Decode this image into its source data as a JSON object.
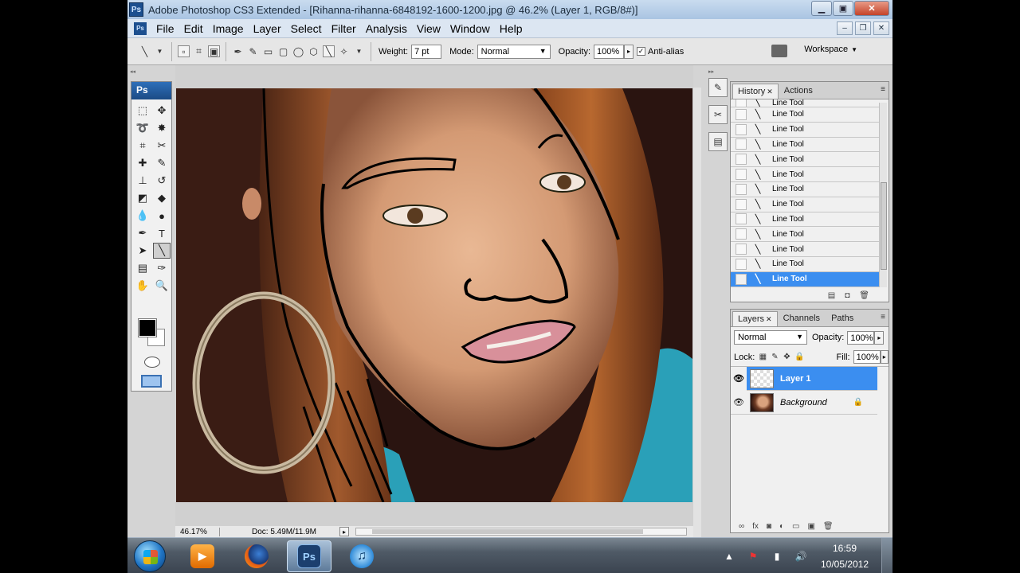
{
  "window": {
    "title": "Adobe Photoshop CS3 Extended - [Rihanna-rihanna-6848192-1600-1200.jpg @ 46.2% (Layer 1, RGB/8#)]",
    "app_badge": "Ps"
  },
  "menu": [
    "File",
    "Edit",
    "Image",
    "Layer",
    "Select",
    "Filter",
    "Analysis",
    "View",
    "Window",
    "Help"
  ],
  "options": {
    "weight_label": "Weight:",
    "weight_value": "7 pt",
    "mode_label": "Mode:",
    "mode_value": "Normal",
    "opacity_label": "Opacity:",
    "opacity_value": "100%",
    "antialias_label": "Anti-alias",
    "antialias_checked": true,
    "workspace_label": "Workspace"
  },
  "toolbox": {
    "logo": "Ps"
  },
  "status": {
    "zoom": "46.17%",
    "doc": "Doc: 5.49M/11.9M"
  },
  "history": {
    "tabs": [
      "History",
      "Actions"
    ],
    "items": [
      "Line Tool",
      "Line Tool",
      "Line Tool",
      "Line Tool",
      "Line Tool",
      "Line Tool",
      "Line Tool",
      "Line Tool",
      "Line Tool",
      "Line Tool",
      "Line Tool",
      "Line Tool",
      "Line Tool"
    ],
    "active_item": "Line Tool"
  },
  "layers": {
    "tabs": [
      "Layers",
      "Channels",
      "Paths"
    ],
    "blend_mode": "Normal",
    "opacity_label": "Opacity:",
    "opacity_value": "100%",
    "lock_label": "Lock:",
    "fill_label": "Fill:",
    "fill_value": "100%",
    "items": [
      "Layer 1",
      "Background"
    ]
  },
  "taskbar": {
    "time": "16:59",
    "date": "10/05/2012",
    "active_app": "Ps"
  },
  "colors": {
    "selection": "#3b8ef0",
    "panel_bg": "#f0f0f0",
    "workspace": "#d4d4d4"
  }
}
